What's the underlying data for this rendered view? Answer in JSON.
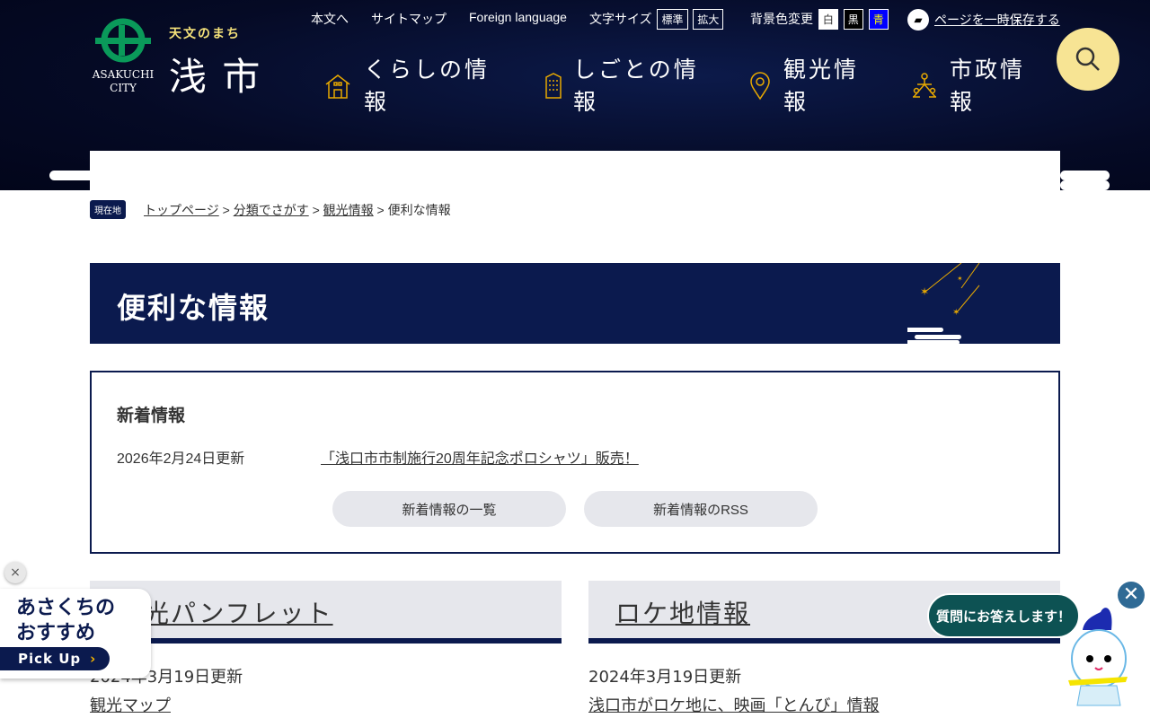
{
  "header": {
    "tagline": "天文のまち",
    "city_name": "浅 市",
    "city_en": "ASAKUCHI CITY",
    "util": {
      "skip": "本文へ",
      "sitemap": "サイトマップ",
      "foreign": "Foreign language",
      "font_size_label": "文字サイズ",
      "font_standard": "標準",
      "font_large": "拡大",
      "bg_label": "背景色変更",
      "bg_white": "白",
      "bg_black": "黒",
      "bg_blue": "青",
      "save_page": "ページを一時保存する"
    },
    "nav": [
      {
        "label": "くらしの情報",
        "icon": "house-icon"
      },
      {
        "label": "しごとの情報",
        "icon": "building-icon"
      },
      {
        "label": "観光情報",
        "icon": "map-pin-icon"
      },
      {
        "label": "市政情報",
        "icon": "people-icon"
      }
    ],
    "accent": "#f5b400"
  },
  "breadcrumb": {
    "here": "現在地",
    "items": [
      "トップページ",
      "分類でさがす",
      "観光情報"
    ],
    "current": "便利な情報"
  },
  "page_title": "便利な情報",
  "news": {
    "heading": "新着情報",
    "date": "2026年2月24日更新",
    "link": "「浅口市市制施行20周年記念ポロシャツ」販売！",
    "list_button": "新着情報の一覧",
    "rss_button": "新着情報のRSS"
  },
  "sections": [
    {
      "title": "観光パンフレット",
      "date": "2024年3月19日更新",
      "link": "観光マップ"
    },
    {
      "title": "ロケ地情報",
      "date": "2024年3月19日更新",
      "link": "浅口市がロケ地に、映画「とんび」情報"
    }
  ],
  "pickup": {
    "title": "あさくちのおすすめ",
    "button": "Pick Up",
    "close": "×"
  },
  "chatbot": {
    "bubble": "質問にお答えします！",
    "close": "✕"
  }
}
